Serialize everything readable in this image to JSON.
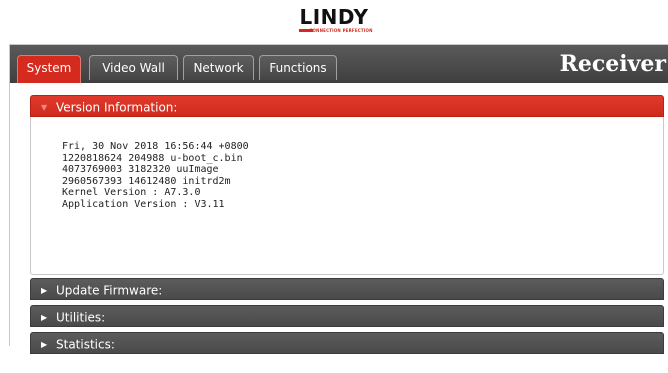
{
  "logo": {
    "text_first": "L",
    "text_rest": "INDY",
    "tagline": "CONNECTION PERFECTION"
  },
  "tabs": [
    {
      "label": "System",
      "active": true
    },
    {
      "label": "Video Wall",
      "active": false
    },
    {
      "label": "Network",
      "active": false
    },
    {
      "label": "Functions",
      "active": false
    }
  ],
  "device_title": "Receiver",
  "sections": {
    "version": {
      "title": "Version Information:",
      "expanded": true,
      "lines": [
        "Fri, 30 Nov 2018 16:56:44 +0800",
        "1220818624 204988 u-boot_c.bin",
        "4073769003 3182320 uuImage",
        "2960567393 14612480 initrd2m",
        "Kernel Version : A7.3.0",
        "Application Version : V3.11"
      ]
    },
    "update_firmware": {
      "title": "Update Firmware:",
      "expanded": false
    },
    "utilities": {
      "title": "Utilities:",
      "expanded": false
    },
    "statistics": {
      "title": "Statistics:",
      "expanded": false
    }
  },
  "icons": {
    "expanded_arrow": "▼",
    "collapsed_arrow": "▶"
  },
  "colors": {
    "accent": "#d52b1e",
    "header_dark": "#4a4a4a",
    "tabbar": "#444444"
  }
}
